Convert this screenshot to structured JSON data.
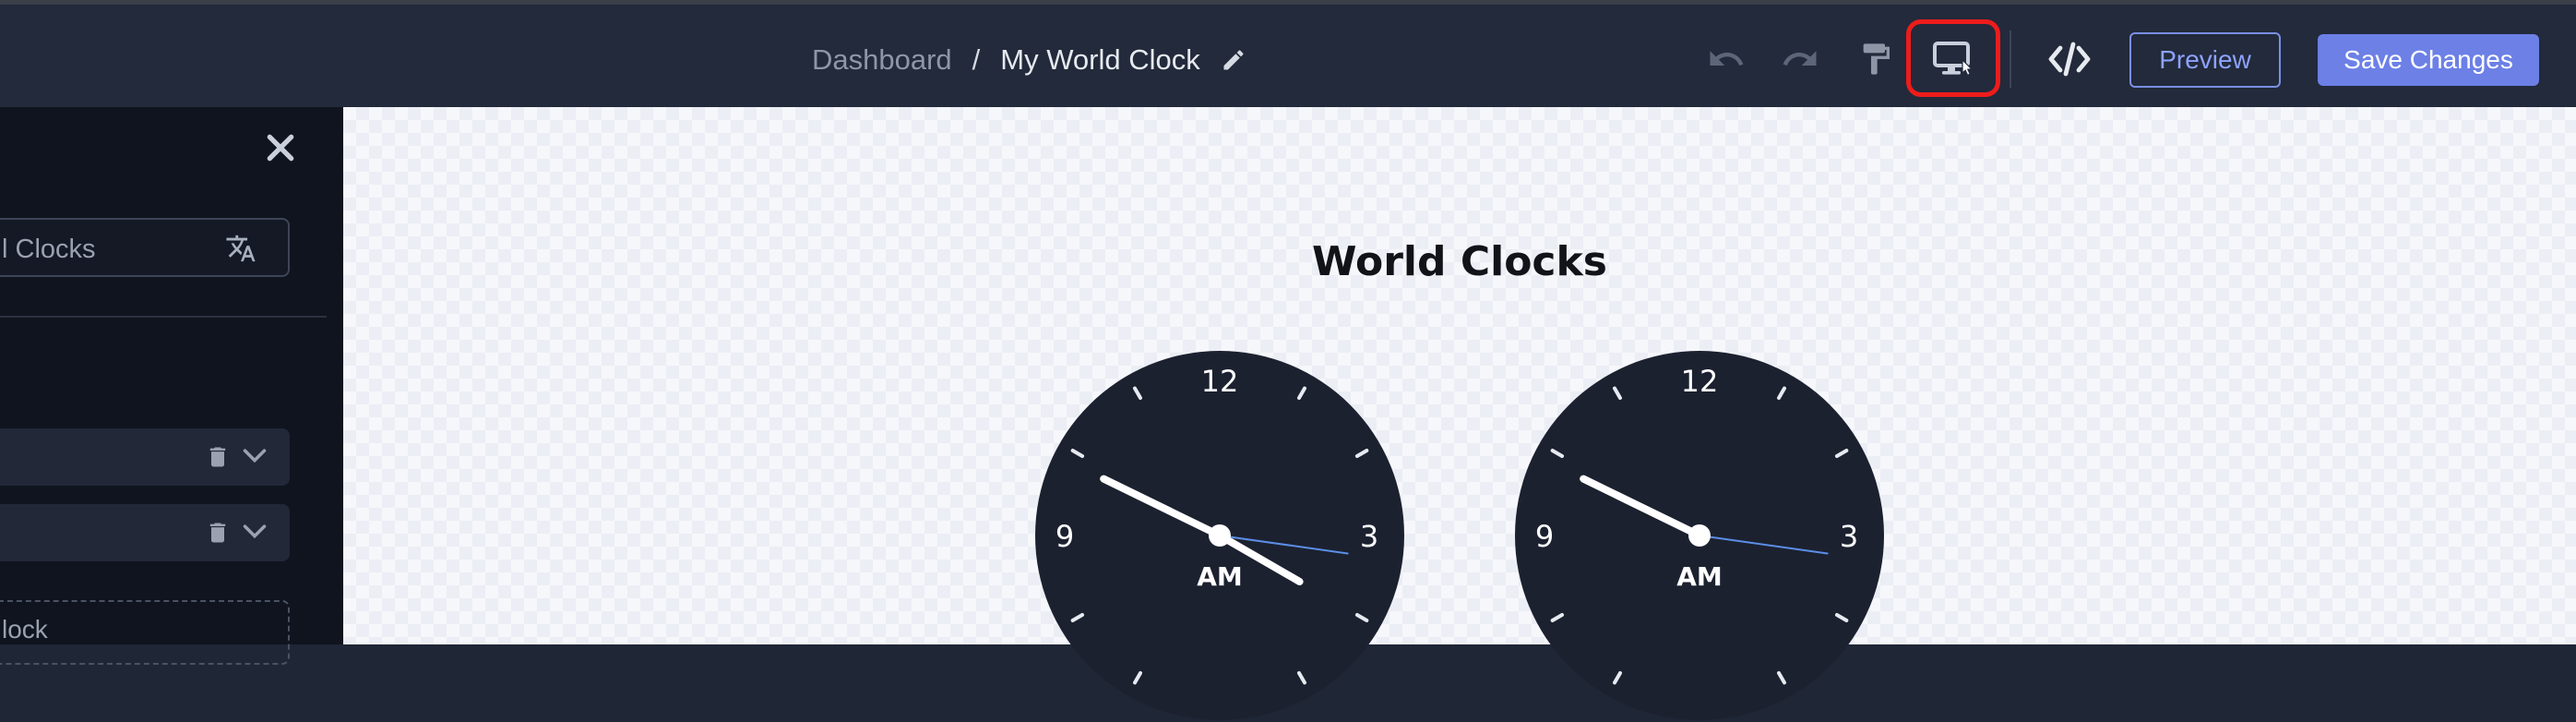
{
  "header": {
    "breadcrumb": {
      "parent": "Dashboard",
      "separator": "/",
      "current": "My World Clock"
    },
    "actions": {
      "preview_label": "Preview",
      "save_label": "Save Changes"
    },
    "icons": [
      "undo-icon",
      "redo-icon",
      "paint-roller-icon",
      "desktop-preview-icon",
      "code-icon",
      "pencil-icon"
    ],
    "highlighted_action": "desktop-preview-icon"
  },
  "sidebar": {
    "title_field_value": "l Clocks",
    "add_item_label": "lock",
    "item_rows": 2
  },
  "canvas": {
    "title": "World Clocks",
    "clocks": [
      {
        "numerals": [
          "12",
          "3",
          "9"
        ],
        "period": "AM",
        "hour_angle": 296,
        "minute_angle": 120,
        "second_angle": 98
      },
      {
        "numerals": [
          "12",
          "3",
          "9"
        ],
        "period": "AM",
        "hour_angle": 296,
        "minute_angle": 296,
        "second_angle": 98
      }
    ]
  },
  "colors": {
    "accent": "#6c80e6",
    "highlight": "#ee1c1c",
    "clock_face": "#1c2130",
    "second_hand": "#5b8ee6"
  }
}
